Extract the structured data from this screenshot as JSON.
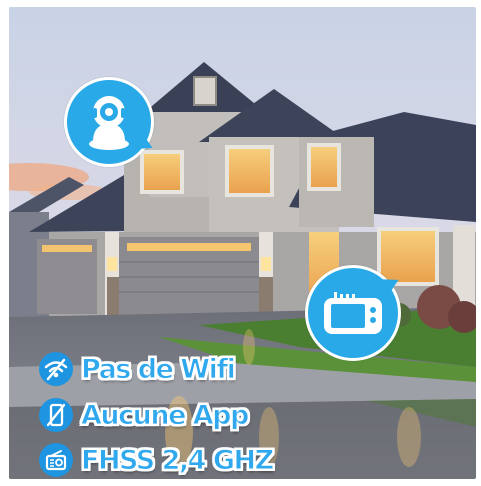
{
  "image": {
    "scene": "suburban-house-at-dusk",
    "icons": [
      "baby-camera-icon",
      "baby-monitor-icon"
    ]
  },
  "features": [
    {
      "label": "Pas de Wifi",
      "icon": "no-wifi-icon"
    },
    {
      "label": "Aucune App",
      "icon": "no-phone-icon"
    },
    {
      "label": "FHSS 2,4 GHZ",
      "icon": "radio-icon"
    }
  ],
  "colors": {
    "accent": "#29a9e8",
    "text_blue": "#2fa8ee"
  }
}
